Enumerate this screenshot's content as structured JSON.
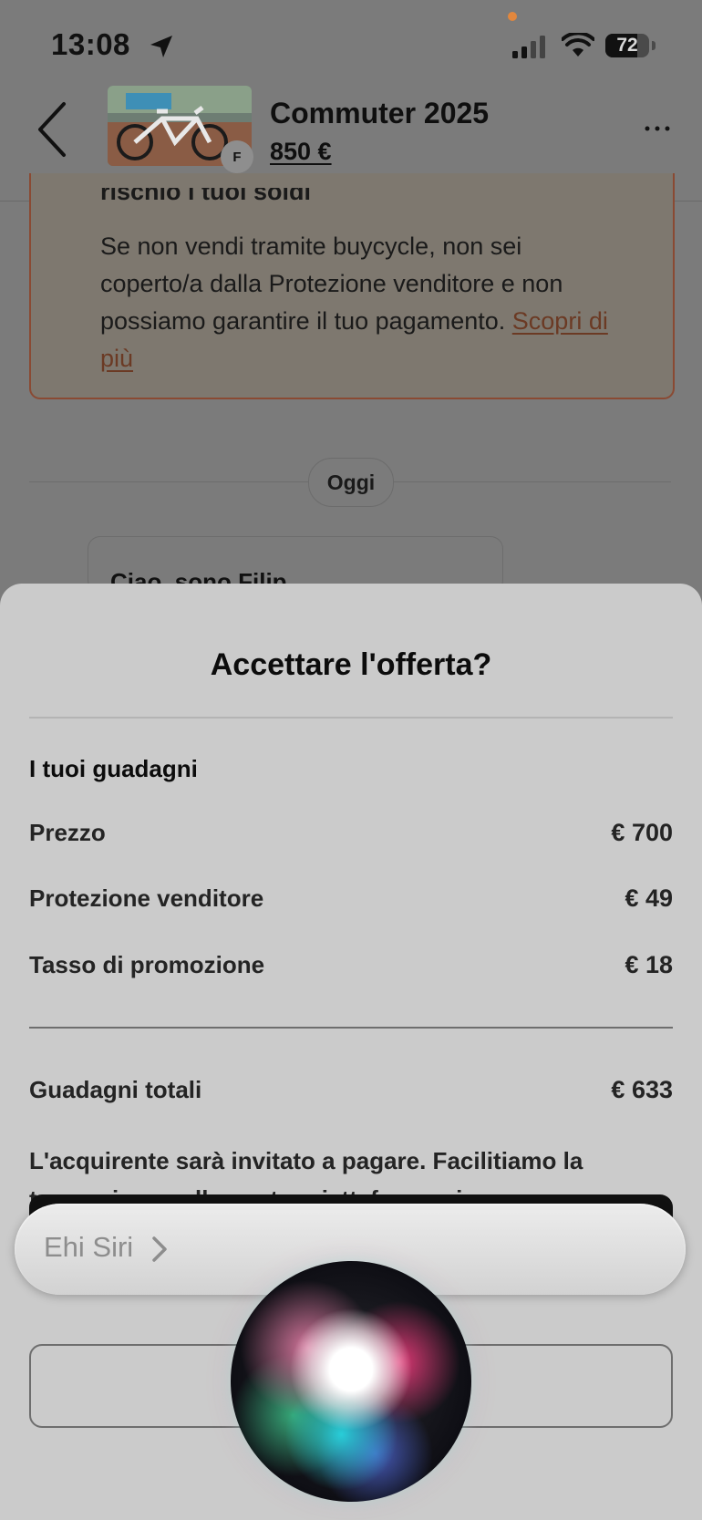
{
  "status_bar": {
    "time": "13:08",
    "battery": "72",
    "battery_level": 0.72
  },
  "header": {
    "title": "Commuter 2025",
    "price": "850 €",
    "seller_initial": "F"
  },
  "chat": {
    "warning_heading_partial": "rischio i tuoi soldi",
    "warning_text": "Se non vendi tramite buycycle, non sei coperto/a dalla Protezione venditore e non possiamo garantire il tuo pagamento.",
    "warning_link": "Scopri di più",
    "day_label": "Oggi",
    "first_message": "Ciao, sono Filip"
  },
  "sheet": {
    "title": "Accettare l'offerta?",
    "section_title": "I tuoi guadagni",
    "rows": [
      {
        "label": "Prezzo",
        "value": "€ 700"
      },
      {
        "label": "Protezione venditore",
        "value": "€ 49"
      },
      {
        "label": "Tasso di promozione",
        "value": "€ 18"
      }
    ],
    "total": {
      "label": "Guadagni totali",
      "value": "€ 633"
    },
    "info": "L'acquirente sarà invitato a pagare. Facilitiamo la transazione sulla nostra piattaforma sicura."
  },
  "siri": {
    "prompt": "Ehi Siri"
  },
  "colors": {
    "dim_background": "#7b7b7b",
    "sheet_background": "#cbcbcb",
    "warning_border": "#8a4a33",
    "primary_button": "#111111"
  }
}
